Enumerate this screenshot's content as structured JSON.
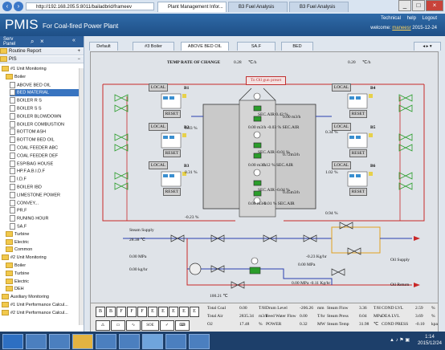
{
  "browser": {
    "address": "http://192.168.205.5:8011/bailadbrid/frameev",
    "tabs": [
      {
        "label": "Plant Management Infor...",
        "active": true
      },
      {
        "label": "B3 Fuel Analysis",
        "active": false
      },
      {
        "label": "B3 Fuel Analysis",
        "active": false
      }
    ]
  },
  "header": {
    "brand": "PMIS",
    "subtitle": "For Coal-fired Power Plant",
    "links": [
      "Technical",
      "help",
      "Logout"
    ],
    "welcome_prefix": "welcome:",
    "user": "maneesr",
    "date": "2015-12-24"
  },
  "sidebar": {
    "title": "Serv Panel",
    "menus": [
      "Routine Report",
      "PIS"
    ],
    "tree": [
      {
        "label": "#1 Unit Monitoring",
        "level": 1,
        "type": "folder"
      },
      {
        "label": "Boiler",
        "level": 2,
        "type": "folder"
      },
      {
        "label": "ABOVE BED OIL",
        "level": 3,
        "type": "doc"
      },
      {
        "label": "BED MATERIAL",
        "level": 3,
        "type": "doc",
        "selected": true
      },
      {
        "label": "BOILER R S",
        "level": 3,
        "type": "doc"
      },
      {
        "label": "BOILER S S",
        "level": 3,
        "type": "doc"
      },
      {
        "label": "BOILER BLOWDOWN",
        "level": 3,
        "type": "doc"
      },
      {
        "label": "BOILER COMBUSTION",
        "level": 3,
        "type": "doc"
      },
      {
        "label": "BOTTOM ASH",
        "level": 3,
        "type": "doc"
      },
      {
        "label": "BOTTOM BED OIL",
        "level": 3,
        "type": "doc"
      },
      {
        "label": "COAL FEEDER ABC",
        "level": 3,
        "type": "doc"
      },
      {
        "label": "COAL FEEDER DEF",
        "level": 3,
        "type": "doc"
      },
      {
        "label": "ESP/BAG HOUSE",
        "level": 3,
        "type": "doc"
      },
      {
        "label": "HP.F.A.B.I.D.F",
        "level": 3,
        "type": "doc"
      },
      {
        "label": "I.D.F",
        "level": 3,
        "type": "doc"
      },
      {
        "label": "BOILER IBD",
        "level": 3,
        "type": "doc"
      },
      {
        "label": "LIMESTONE POWER",
        "level": 3,
        "type": "doc"
      },
      {
        "label": "CONVEY...",
        "level": 3,
        "type": "doc"
      },
      {
        "label": "PR.F",
        "level": 3,
        "type": "doc"
      },
      {
        "label": "RUNING HOUR",
        "level": 3,
        "type": "doc"
      },
      {
        "label": "SA.F",
        "level": 3,
        "type": "doc"
      },
      {
        "label": "Turbine",
        "level": 2,
        "type": "folder"
      },
      {
        "label": "Electric",
        "level": 2,
        "type": "folder"
      },
      {
        "label": "Common",
        "level": 2,
        "type": "folder"
      },
      {
        "label": "#2 Unit Monitoring",
        "level": 1,
        "type": "folder"
      },
      {
        "label": "Boiler",
        "level": 2,
        "type": "folder"
      },
      {
        "label": "Turbine",
        "level": 2,
        "type": "folder"
      },
      {
        "label": "Electric",
        "level": 2,
        "type": "folder"
      },
      {
        "label": "DEH",
        "level": 2,
        "type": "folder"
      },
      {
        "label": "Auxiliary Monitoring",
        "level": 1,
        "type": "folder"
      },
      {
        "label": "#1 Unit Performance Calcul...",
        "level": 1,
        "type": "folder"
      },
      {
        "label": "#2 Unit Performance Calcul...",
        "level": 1,
        "type": "folder"
      }
    ]
  },
  "page_tabs": [
    {
      "label": "Default",
      "active": false
    },
    {
      "label": "#3 Boiler",
      "active": false
    },
    {
      "label": "ABOVE BED OIL",
      "active": true
    },
    {
      "label": "SA.F",
      "active": false
    },
    {
      "label": "BED",
      "active": false
    }
  ],
  "diagram": {
    "temp_rate_label": "TEMP RATE OF CHANGE",
    "temp_rate_left": "0.28",
    "temp_rate_right": "0.20",
    "temp_unit": "℃/h",
    "oil_gun_btn": "To Oil gun preset",
    "local": "LOCAL",
    "reset": "RESET",
    "burners": {
      "b1": "B1",
      "b2": "B2",
      "b3": "B3",
      "b4": "B4",
      "b5": "B5",
      "b6": "B6"
    },
    "left_pcts": [
      "0.83 %",
      "0.31 %",
      "-0.23 %"
    ],
    "right_pcts": [
      "0.34 %",
      "1.02 %",
      "0.94 %"
    ],
    "sec_air": [
      {
        "a": "SEC.AIR 0.42 %",
        "b": "0.00 m3/h",
        "c": "0.00 m3/h -0.03 % SEC.AIR"
      },
      {
        "a": "SEC.AIR -0.01 %",
        "b": "0.72m3/h",
        "c": "0.12 % SEC.AIR"
      },
      {
        "a": "SEC.AIR -0.04 %",
        "b": "0.45m3/h",
        "c": "-0.01 % SEC.AIR"
      }
    ],
    "left_flows": [
      "0.00 m3/h",
      "0.00 m3/h",
      "0.00 m3/h"
    ],
    "steam_supply_label": "Steam Supply",
    "steam_supply_val": "28.38 ℃",
    "mpa_left": "0.00 MPa",
    "kg_left": "0.00 kg/hr",
    "kg_mid": "-0.23 Kg/hr",
    "mpa_mid": "0.00 MPa",
    "deg_bottom": "100.21 ℃",
    "mpa_bottom": "0.00 MPa -0.11 Kg/hr",
    "oil_supply": "Oil Supply",
    "oil_return": "Oil Return"
  },
  "statusbar": {
    "boxes": [
      "B",
      "B",
      "F",
      "F",
      "F",
      "E",
      "E",
      "E",
      "E",
      "E"
    ],
    "tools": [
      "",
      "",
      "",
      "SOE",
      "",
      ""
    ],
    "col1": [
      [
        "Total Coal",
        "0.00",
        "T/H"
      ],
      [
        "Total Air",
        "2835.34",
        "m3/h"
      ],
      [
        "O2",
        "17.48",
        "%"
      ]
    ],
    "col2": [
      [
        "Drum Level",
        "-206.26",
        "mm"
      ],
      [
        "Feed Water Flow",
        "0.00",
        "T/hr"
      ],
      [
        "POWER",
        "0.32",
        "MW"
      ]
    ],
    "col3": [
      [
        "Steam Flow",
        "3.36",
        "T/H"
      ],
      [
        "Steam Press",
        "0.04",
        "MPa"
      ],
      [
        "Steam Temp",
        "31.98",
        "℃"
      ]
    ],
    "col4": [
      [
        "COND LVL",
        "2.59",
        "%"
      ],
      [
        "DEA LVL",
        "3.69",
        "%"
      ],
      [
        "COND PRESS",
        "-0.10",
        "kpa"
      ]
    ]
  },
  "taskbar": {
    "time": "1:14",
    "date": "2015/12/24"
  },
  "colors": {
    "pipe_red": "#c82828",
    "pipe_blue": "#2a3fb0",
    "valve_green": "#2a9d2a",
    "header_blue": "#2a5f9e"
  }
}
